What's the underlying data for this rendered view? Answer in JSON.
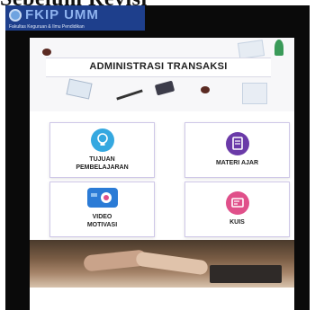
{
  "heading": "Sebelum Revisi",
  "brand": {
    "name": "FKIP UMM",
    "subtitle": "Fakultas Keguruan & Ilmu Pendidikan"
  },
  "title": "ADMINISTRASI TRANSAKSI",
  "menu": [
    {
      "label_lines": [
        "TUJUAN",
        "PEMBELAJARAN"
      ],
      "icon": "lightbulb-icon",
      "icon_color": "#35a8e0"
    },
    {
      "label_lines": [
        "MATERI AJAR"
      ],
      "icon": "book-icon",
      "icon_color": "#6a3aa8"
    },
    {
      "label_lines": [
        "VIDEO",
        "MOTIVASI"
      ],
      "icon": "video-camera-icon",
      "icon_color": "#2b7bd6"
    },
    {
      "label_lines": [
        "KUIS"
      ],
      "icon": "quiz-icon",
      "icon_color": "#e0508a"
    }
  ],
  "colors": {
    "frame": "#0a0a0a",
    "brand_bar": "#1e3f8c",
    "card_border": "#cfc8e8"
  }
}
